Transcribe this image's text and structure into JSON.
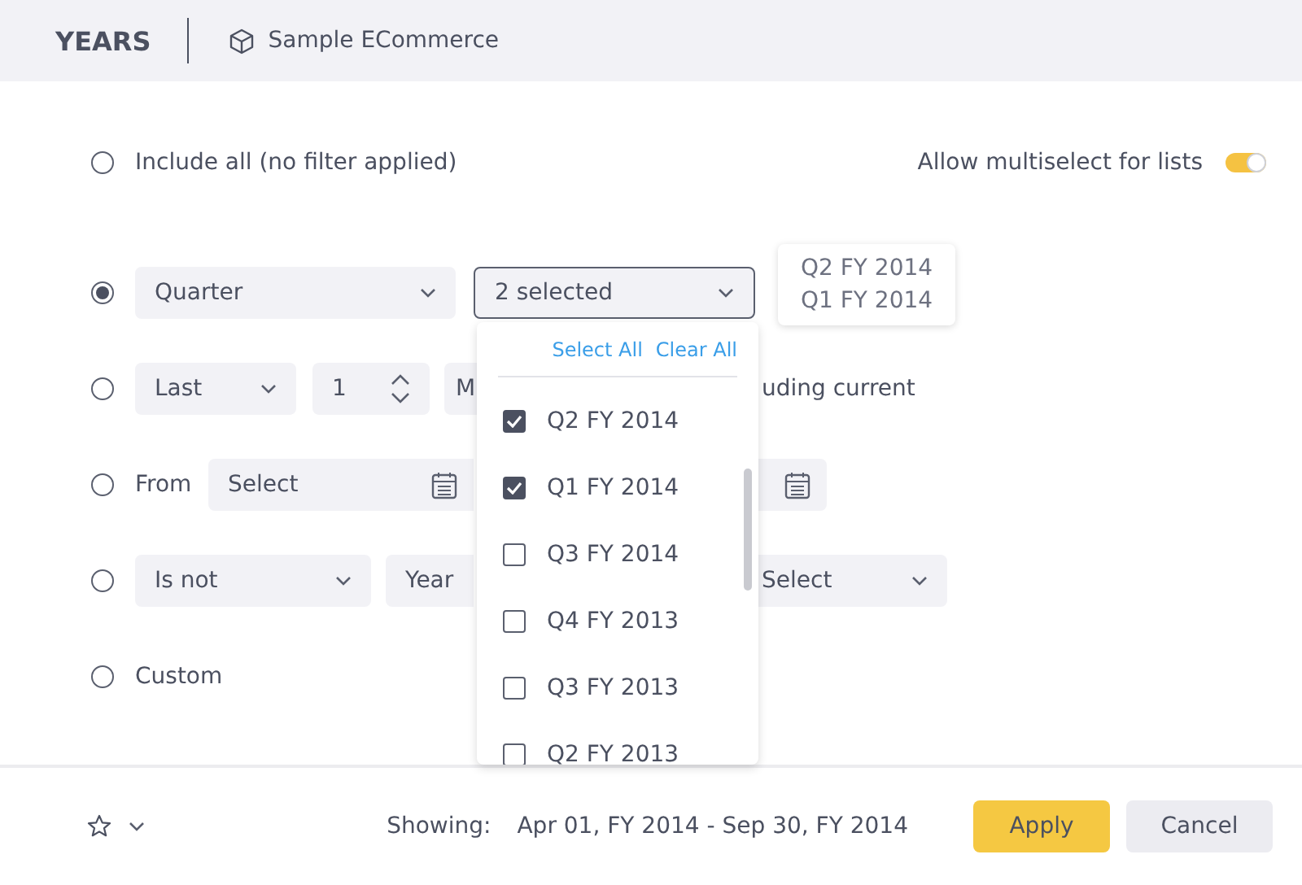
{
  "header": {
    "title": "YEARS",
    "source": "Sample ECommerce"
  },
  "multiselect": {
    "label": "Allow multiselect for lists",
    "on": true
  },
  "options": [
    {
      "selected": false,
      "label": "Include all (no filter applied)"
    },
    {
      "selected": true,
      "controls": [
        {
          "kind": "select",
          "value": "Quarter"
        },
        {
          "kind": "multiselect",
          "value": "2 selected"
        }
      ]
    },
    {
      "selected": false,
      "controls": [
        {
          "kind": "select",
          "value": "Last"
        },
        {
          "kind": "spinner",
          "value": "1"
        },
        {
          "kind": "field",
          "value": "M"
        },
        {
          "kind": "text",
          "value": "uding current"
        }
      ]
    },
    {
      "selected": false,
      "controls": [
        {
          "kind": "text",
          "value": "From"
        },
        {
          "kind": "date",
          "value": "Select"
        },
        {
          "kind": "date"
        }
      ]
    },
    {
      "selected": false,
      "controls": [
        {
          "kind": "select",
          "value": "Is not"
        },
        {
          "kind": "field",
          "value": "Year"
        },
        {
          "kind": "select",
          "value": "Select"
        }
      ]
    },
    {
      "selected": false,
      "label": "Custom"
    }
  ],
  "tooltip": {
    "lines": [
      "Q2 FY 2014",
      "Q1 FY 2014"
    ]
  },
  "dropdown": {
    "actions": [
      "Select All",
      "Clear All"
    ],
    "items": [
      {
        "label": "Q2 FY 2014",
        "checked": true
      },
      {
        "label": "Q1 FY 2014",
        "checked": true
      },
      {
        "label": "Q3 FY 2014",
        "checked": false
      },
      {
        "label": "Q4 FY 2013",
        "checked": false
      },
      {
        "label": "Q3 FY 2013",
        "checked": false
      },
      {
        "label": "Q2 FY 2013",
        "checked": false
      }
    ]
  },
  "footer": {
    "showing_label": "Showing:",
    "range": "Apr 01, FY 2014 - Sep 30, FY 2014",
    "buttons": [
      {
        "label": "Apply",
        "kind": "primary"
      },
      {
        "label": "Cancel",
        "kind": "secondary"
      }
    ]
  }
}
